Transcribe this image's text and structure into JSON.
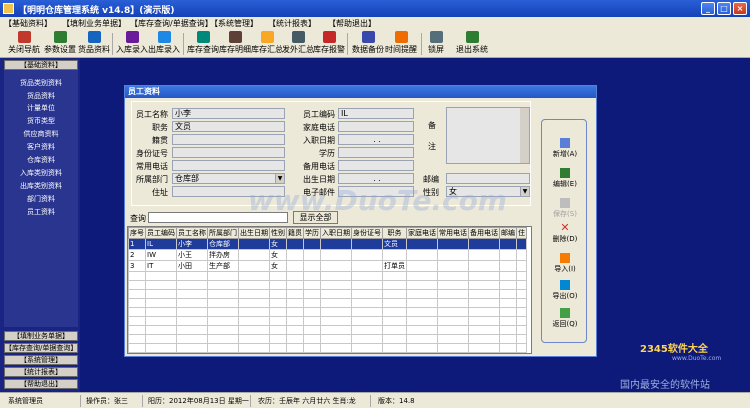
{
  "window": {
    "title": "【明明仓库管理系统 v14.8】(演示版)",
    "min": "_",
    "max": "□",
    "close": "×"
  },
  "menu": [
    "【基础资料】",
    "【填制业务单据】",
    "【库存查询/单据查询】",
    "【系统管理】",
    "【统计报表】",
    "【帮助退出】"
  ],
  "toolbar": [
    "关闭导航",
    "参数设置",
    "货品资料",
    "入库录入",
    "出库录入",
    "库存查询",
    "库存明细",
    "库存汇总",
    "发外汇总",
    "库存报警",
    "数据备份",
    "时间提醒",
    "锁屏",
    "退出系统"
  ],
  "toolbar_icon_colors": [
    "#c0392b",
    "#2e7d32",
    "#1565c0",
    "#6a1b9a",
    "#1e88e5",
    "#00897b",
    "#5d4037",
    "#f9a825",
    "#455a64",
    "#c62828",
    "#3949ab",
    "#ef6c00",
    "#546e7a",
    "#2e7d32"
  ],
  "sidebar": {
    "top_header": "【基础资料】",
    "items": [
      "货品类别资料",
      "货品资料",
      "计量单位",
      "货币类型",
      "供应商资料",
      "客户资料",
      "仓库资料",
      "入库类别资料",
      "出库类别资料",
      "部门资料",
      "员工资料"
    ],
    "bottom_headers": [
      "【填制业务单据】",
      "【库存查询/单据查询】",
      "【系统管理】",
      "【统计报表】",
      "【帮助退出】"
    ]
  },
  "dialog": {
    "title": "员工资料",
    "labels": {
      "name": "员工名称",
      "post": "职务",
      "native": "籍贯",
      "idcard": "身份证号",
      "phone": "常用电话",
      "dept": "所属部门",
      "addr": "住址",
      "code": "员工编码",
      "homephone": "家庭电话",
      "joindate": "入职日期",
      "edu": "学历",
      "altphone": "备用电话",
      "birth": "出生日期",
      "email": "电子邮件",
      "remark1": "备",
      "remark2": "注",
      "zip": "邮编",
      "gender": "性别"
    },
    "values": {
      "name": "小李",
      "post": "文员",
      "native": "",
      "idcard": "",
      "phone": "",
      "dept": "仓库部",
      "addr": "",
      "code": "IL",
      "homephone": "",
      "joindate": ". .",
      "edu": "",
      "altphone": "",
      "birth": ". .",
      "email": "",
      "remark": "",
      "zip": "",
      "gender": "女"
    },
    "search_label": "查询",
    "search_value": "",
    "show_all": "显示全部",
    "buttons": [
      "新增(A)",
      "编辑(E)",
      "保存(S)",
      "删除(D)",
      "导入(I)",
      "导出(O)",
      "返回(Q)"
    ]
  },
  "grid": {
    "columns": [
      "序号",
      "员工编码",
      "员工名称",
      "所属部门",
      "出生日期",
      "性别",
      "籍贯",
      "学历",
      "入职日期",
      "身份证号",
      "职务",
      "家庭电话",
      "常用电话",
      "备用电话",
      "邮编",
      "住"
    ],
    "rows": [
      [
        "1",
        "IL",
        "小李",
        "仓库部",
        "",
        "女",
        "",
        "",
        "",
        "",
        "文员",
        "",
        "",
        "",
        "",
        ""
      ],
      [
        "2",
        "IW",
        "小王",
        "拌办房",
        "",
        "女",
        "",
        "",
        "",
        "",
        "",
        "",
        "",
        "",
        "",
        ""
      ],
      [
        "3",
        "IT",
        "小田",
        "生产部",
        "",
        "女",
        "",
        "",
        "",
        "",
        "打单员",
        "",
        "",
        "",
        "",
        ""
      ]
    ]
  },
  "watermark": "www.DuoTe.com",
  "brand": {
    "line1": "2345软件大全",
    "line2": "国内最安全的软件站",
    "url": "www.DuoTe.com"
  },
  "status": [
    "系统管理员",
    "操作员：张三",
    "阳历：2012年08月13日 星期一",
    "农历：壬辰年 六月廿六 生肖:龙",
    "版本：14.8"
  ]
}
